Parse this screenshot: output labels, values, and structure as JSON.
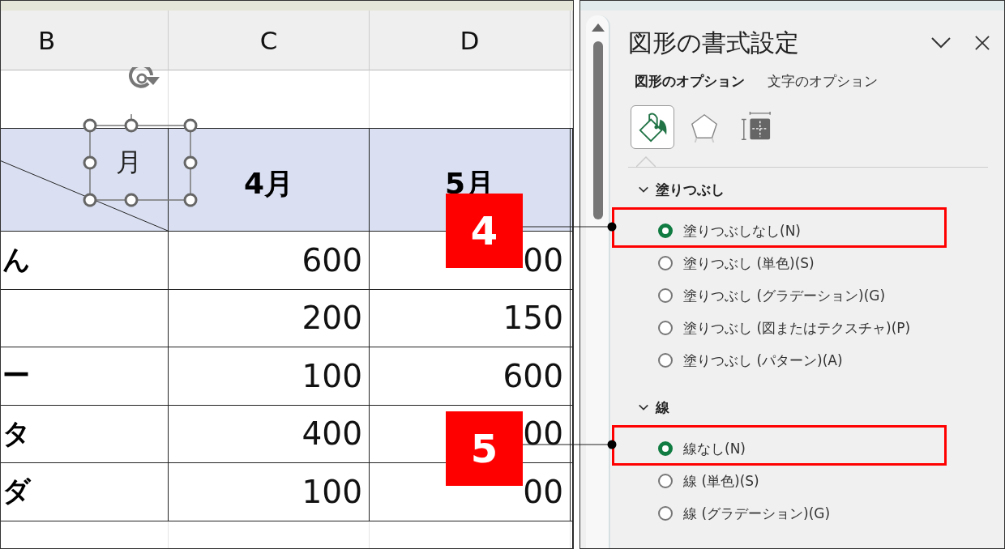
{
  "sheet": {
    "columns": [
      "B",
      "C",
      "D"
    ],
    "header_row": {
      "shape_text": "月",
      "cells": [
        "4月",
        "5月"
      ]
    },
    "rows": [
      {
        "label": "ん",
        "c": "600",
        "d": "00"
      },
      {
        "label": "",
        "c": "200",
        "d": "150"
      },
      {
        "label": "ー",
        "c": "100",
        "d": "600"
      },
      {
        "label": "タ",
        "c": "400",
        "d": "00"
      },
      {
        "label": "ダ",
        "c": "100",
        "d": "00"
      }
    ]
  },
  "format_pane": {
    "title": "図形の書式設定",
    "tabs": [
      {
        "label": "図形のオプション",
        "selected": true
      },
      {
        "label": "文字のオプション",
        "selected": false
      }
    ],
    "icon_tabs": [
      {
        "kind": "fill",
        "selected": true
      },
      {
        "kind": "effects",
        "selected": false
      },
      {
        "kind": "size",
        "selected": false
      }
    ],
    "sections": [
      {
        "title": "塗りつぶし",
        "expanded": true,
        "options": [
          {
            "label": "塗りつぶしなし(N)",
            "selected": true,
            "callout": "4"
          },
          {
            "label": "塗りつぶし (単色)(S)",
            "selected": false
          },
          {
            "label": "塗りつぶし (グラデーション)(G)",
            "selected": false
          },
          {
            "label": "塗りつぶし (図またはテクスチャ)(P)",
            "selected": false
          },
          {
            "label": "塗りつぶし (パターン)(A)",
            "selected": false
          }
        ]
      },
      {
        "title": "線",
        "expanded": true,
        "options": [
          {
            "label": "線なし(N)",
            "selected": true,
            "callout": "5"
          },
          {
            "label": "線 (単色)(S)",
            "selected": false
          },
          {
            "label": "線 (グラデーション)(G)",
            "selected": false
          }
        ]
      }
    ]
  }
}
